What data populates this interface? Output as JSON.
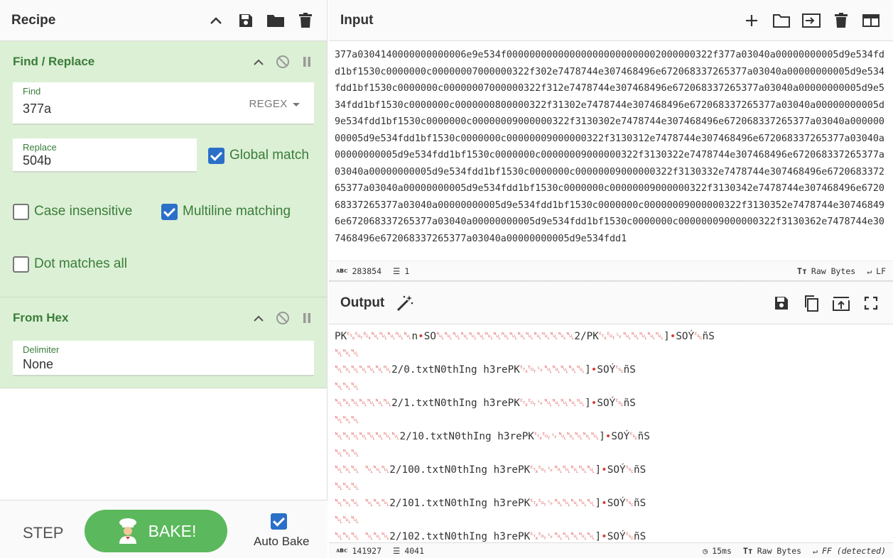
{
  "recipe": {
    "title": "Recipe",
    "find_replace": {
      "title": "Find / Replace",
      "find_label": "Find",
      "find_value": "377a",
      "find_mode": "REGEX",
      "replace_label": "Replace",
      "replace_value": "504b",
      "global_match_label": "Global match",
      "global_match": true,
      "case_insensitive_label": "Case insensitive",
      "case_insensitive": false,
      "multiline_label": "Multiline matching",
      "multiline": true,
      "dotall_label": "Dot matches all",
      "dotall": false
    },
    "from_hex": {
      "title": "From Hex",
      "delimiter_label": "Delimiter",
      "delimiter_value": "None"
    }
  },
  "controls": {
    "step_label": "STEP",
    "bake_label": "BAKE!",
    "auto_bake_label": "Auto Bake",
    "auto_bake": true
  },
  "input": {
    "title": "Input",
    "text": "377a0304140000000000006e9e534f000000000000000000000000002000000322f377a03040a00000000005d9e534fdd1bf1530c0000000c00000007000000322f302e7478744e307468496e672068337265377a03040a00000000005d9e534fdd1bf1530c0000000c00000007000000322f312e7478744e307468496e672068337265377a03040a00000000005d9e534fdd1bf1530c0000000c0000000800000322f31302e7478744e307468496e672068337265377a03040a00000000005d9e534fdd1bf1530c0000000c00000009000000322f3130302e7478744e307468496e672068337265377a03040a00000000005d9e534fdd1bf1530c0000000c00000009000000322f3130312e7478744e307468496e672068337265377a03040a00000000005d9e534fdd1bf1530c0000000c00000009000000322f3130322e7478744e307468496e672068337265377a03040a00000000005d9e534fdd1bf1530c0000000c00000009000000322f3130332e7478744e307468496e672068337265377a03040a00000000005d9e534fdd1bf1530c0000000c00000009000000322f3130342e7478744e307468496e672068337265377a03040a00000000005d9e534fdd1bf1530c0000000c00000009000000322f3130352e7478744e307468496e672068337265377a03040a00000000005d9e534fdd1bf1530c0000000c00000009000000322f3130362e7478744e307468496e672068337265377a03040a00000000005d9e534fdd1",
    "length": "283854",
    "lines": "1",
    "encoding": "Raw Bytes",
    "eol": "LF"
  },
  "output": {
    "title": "Output",
    "lines": [
      "PK␃␄␔␀␀␀␀␀n•SO␀␀␀␀␀␀␀␀␀␀␀␀␀␀␀␀␀2/PK␃␄␊␀␀␀␀␀]•SOÝ␛ñS",
      "␀␀␀",
      "␀␀␀␀␀␀␀2/0.txtN0thIng h3rePK␃␄␊␀␀␀␀␀]•SOÝ␛ñS",
      "␀␀␀",
      "␀␀␀␀␀␀␀2/1.txtN0thIng h3rePK␃␄␊␀␀␀␀␀]•SOÝ␛ñS",
      "␀␀␀",
      "␀␀␀␀␀␀␀␀2/10.txtN0thIng h3rePK␃␄␊␀␀␀␀␀]•SOÝ␛ñS",
      "␀␀␀",
      "␀␀␀ ␀␀␀2/100.txtN0thIng h3rePK␃␄␊␀␀␀␀␀]•SOÝ␛ñS",
      "␀␀␀",
      "␀␀␀ ␀␀␀2/101.txtN0thIng h3rePK␃␄␊␀␀␀␀␀]•SOÝ␛ñS",
      "␀␀␀",
      "␀␀␀ ␀␀␀2/102.txtN0thIng h3rePK␃␄␊␀␀␀␀␀]•SOÝ␛ñS"
    ],
    "length": "141927",
    "lines_count": "4041",
    "time": "15ms",
    "encoding": "Raw Bytes",
    "eol": "FF (detected)"
  },
  "colors": {
    "op_bg": "#dcf0d5",
    "op_text": "#3a7d3a",
    "bake": "#5cb85c",
    "checkbox": "#2a70c8",
    "control_char": "#d6403a"
  }
}
